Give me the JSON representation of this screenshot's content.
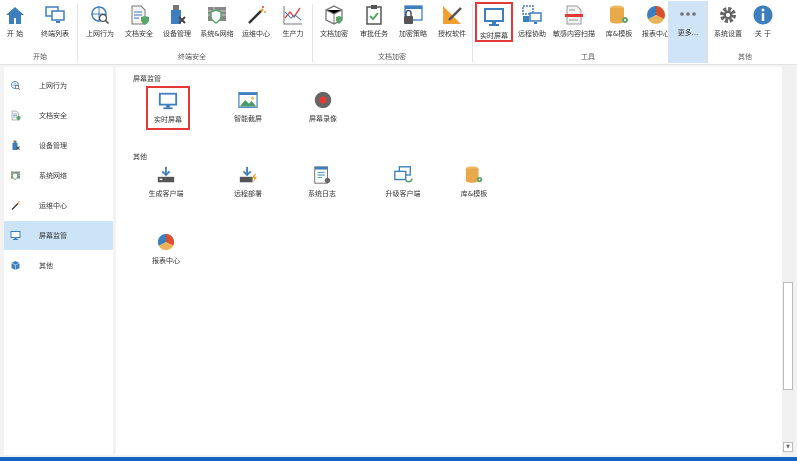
{
  "ribbon": {
    "buttons": [
      {
        "label": "开 始",
        "icon": "home-icon"
      },
      {
        "label": "终端列表",
        "icon": "monitors-icon"
      },
      {
        "label": "上网行为",
        "icon": "globe-search-icon"
      },
      {
        "label": "文档安全",
        "icon": "document-shield-icon"
      },
      {
        "label": "设备管理",
        "icon": "usb-device-icon"
      },
      {
        "label": "系统&网络",
        "icon": "firewall-shield-icon"
      },
      {
        "label": "运维中心",
        "icon": "magic-wand-icon"
      },
      {
        "label": "生产力",
        "icon": "productivity-chart-icon"
      },
      {
        "label": "文档加密",
        "icon": "box-shield-icon"
      },
      {
        "label": "审批任务",
        "icon": "clipboard-check-icon"
      },
      {
        "label": "加密策略",
        "icon": "lock-window-icon"
      },
      {
        "label": "授权软件",
        "icon": "ruler-pencil-icon"
      },
      {
        "label": "实时屏幕",
        "icon": "monitor-icon"
      },
      {
        "label": "远程协助",
        "icon": "remote-assist-icon"
      },
      {
        "label": "敏感内容扫描",
        "icon": "document-scan-icon"
      },
      {
        "label": "库&模板",
        "icon": "database-gear-icon"
      },
      {
        "label": "报表中心",
        "icon": "pie-chart-icon"
      },
      {
        "label": "更多...",
        "icon": "more-icon"
      },
      {
        "label": "系统设置",
        "icon": "gear-icon"
      },
      {
        "label": "关 于",
        "icon": "info-icon"
      }
    ],
    "groups": [
      "开始",
      "终端安全",
      "文档加密",
      "工具",
      "其他"
    ]
  },
  "sidebar": {
    "items": [
      {
        "label": "上网行为",
        "icon": "globe-search-icon"
      },
      {
        "label": "文档安全",
        "icon": "document-shield-icon"
      },
      {
        "label": "设备管理",
        "icon": "usb-device-icon"
      },
      {
        "label": "系统网络",
        "icon": "firewall-shield-icon"
      },
      {
        "label": "运维中心",
        "icon": "magic-wand-icon"
      },
      {
        "label": "屏幕监管",
        "icon": "monitor-icon",
        "active": true
      },
      {
        "label": "其他",
        "icon": "cube-icon"
      }
    ]
  },
  "main": {
    "section1": {
      "title": "屏幕监管",
      "items": [
        "实时屏幕",
        "智能截屏",
        "屏幕录像"
      ]
    },
    "section2": {
      "title": "其他",
      "items": [
        "生成客户端",
        "远程部署",
        "系统日志",
        "升级客户端",
        "库&模板",
        "报表中心"
      ]
    }
  },
  "colors": {
    "accent": "#3d7ebf",
    "selected_border": "#e53935",
    "active_bg": "#cce4f7",
    "status_bar": "#1565c0"
  }
}
